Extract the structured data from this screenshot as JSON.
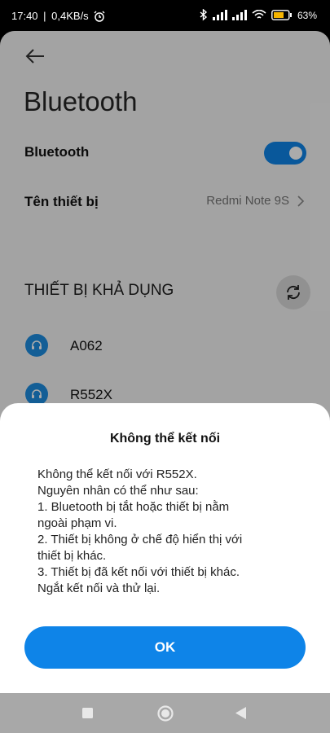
{
  "status": {
    "time": "17:40",
    "network_speed": "0,4KB/s",
    "battery_percent": "63%",
    "icons": [
      "alarm-icon",
      "bluetooth-icon",
      "signal-icon",
      "signal-icon",
      "wifi-icon",
      "battery-icon"
    ]
  },
  "colors": {
    "accent": "#0e84e8",
    "device_icon": "#1d8ce0"
  },
  "page": {
    "title": "Bluetooth"
  },
  "bluetooth_row": {
    "label": "Bluetooth",
    "enabled": true
  },
  "device_name_row": {
    "label": "Tên thiết bị",
    "value": "Redmi Note 9S"
  },
  "available": {
    "title": "THIẾT BỊ KHẢ DỤNG",
    "devices": [
      {
        "name": "A062",
        "icon": "headset-icon"
      },
      {
        "name": "R552X",
        "icon": "headset-icon"
      }
    ]
  },
  "dialog": {
    "title": "Không thể kết nối",
    "lines": [
      "Không thể kết nối với R552X.",
      "Nguyên nhân có thể như sau:",
      "1. Bluetooth bị tắt hoặc thiết bị nằm",
      "ngoài phạm vi.",
      "2. Thiết bị không ở chế độ hiển thị với",
      "thiết bị khác.",
      "3. Thiết bị đã kết nối với thiết bị khác.",
      "Ngắt kết nối và thử lại."
    ],
    "ok_label": "OK"
  },
  "nav": {
    "items": [
      "recents-icon",
      "home-icon",
      "back-nav-icon"
    ]
  }
}
